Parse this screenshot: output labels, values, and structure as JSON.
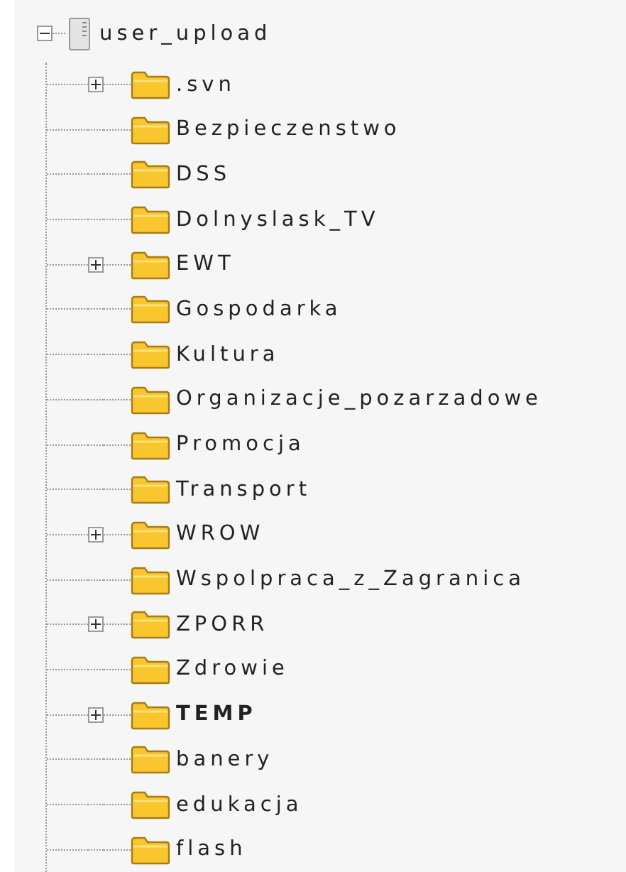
{
  "tree": {
    "label": "user_upload",
    "expanded": true,
    "children": [
      {
        "label": ".svn",
        "has_children": true,
        "bold": false
      },
      {
        "label": "Bezpieczenstwo",
        "has_children": false,
        "bold": false
      },
      {
        "label": "DSS",
        "has_children": false,
        "bold": false
      },
      {
        "label": "Dolnyslask_TV",
        "has_children": false,
        "bold": false
      },
      {
        "label": "EWT",
        "has_children": true,
        "bold": false
      },
      {
        "label": "Gospodarka",
        "has_children": false,
        "bold": false
      },
      {
        "label": "Kultura",
        "has_children": false,
        "bold": false
      },
      {
        "label": "Organizacje_pozarzadowe",
        "has_children": false,
        "bold": false
      },
      {
        "label": "Promocja",
        "has_children": false,
        "bold": false
      },
      {
        "label": "Transport",
        "has_children": false,
        "bold": false
      },
      {
        "label": "WROW",
        "has_children": true,
        "bold": false
      },
      {
        "label": "Wspolpraca_z_Zagranica",
        "has_children": false,
        "bold": false
      },
      {
        "label": "ZPORR",
        "has_children": true,
        "bold": false
      },
      {
        "label": "Zdrowie",
        "has_children": false,
        "bold": false
      },
      {
        "label": "TEMP",
        "has_children": true,
        "bold": true
      },
      {
        "label": "banery",
        "has_children": false,
        "bold": false
      },
      {
        "label": "edukacja",
        "has_children": false,
        "bold": false
      },
      {
        "label": "flash",
        "has_children": false,
        "bold": false
      }
    ]
  }
}
